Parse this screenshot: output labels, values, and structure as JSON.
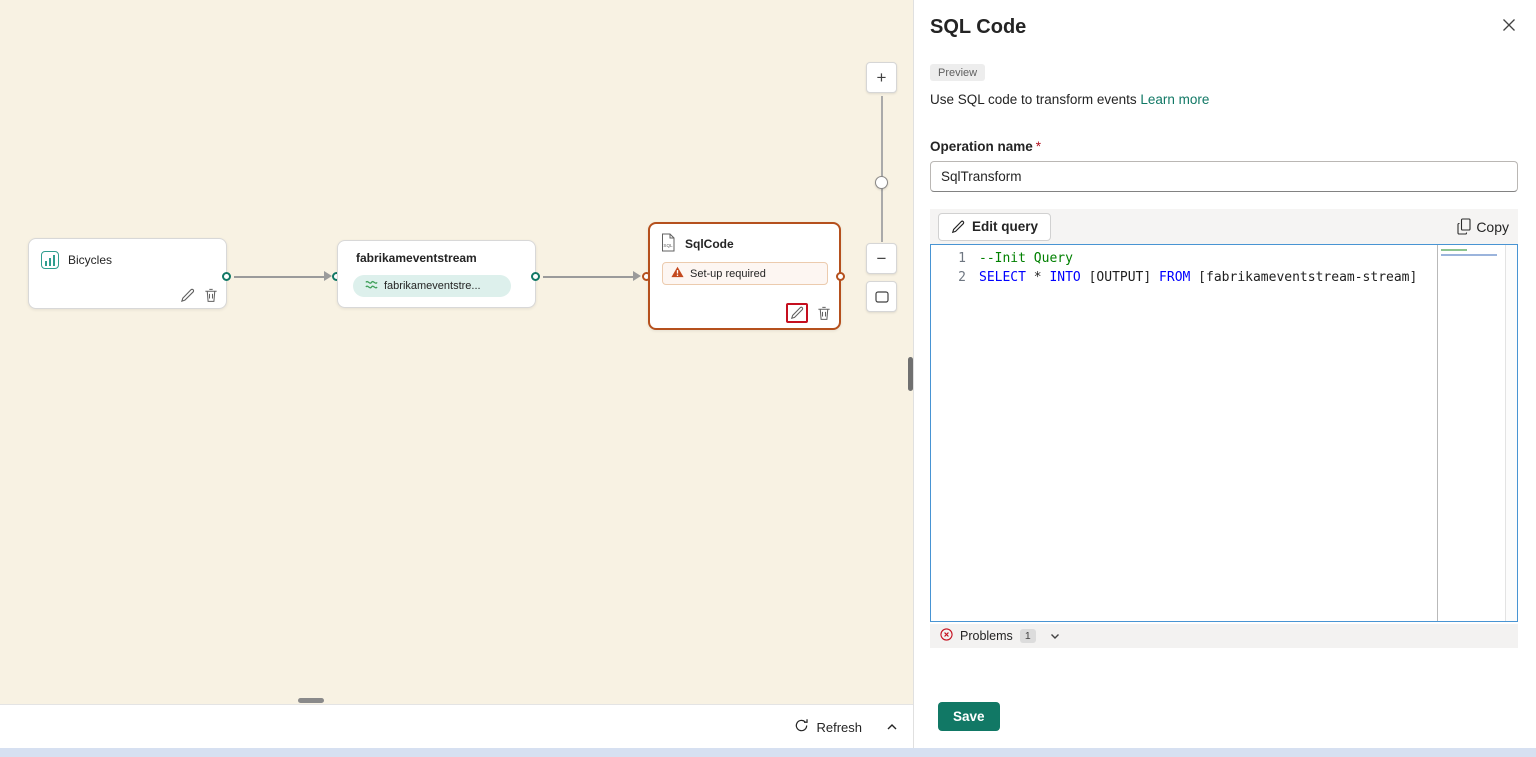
{
  "colors": {
    "accent_teal": "#117865",
    "warning_orange": "#b5501d",
    "error_red": "#c50f1f",
    "canvas_bg": "#f8f2e3",
    "keyword_blue": "#0000ff",
    "comment_green": "#008000"
  },
  "canvas": {
    "nodes": {
      "bicycles": {
        "title": "Bicycles"
      },
      "eventstream": {
        "title": "fabrikameventstream",
        "badge": "fabrikameventstre..."
      },
      "sqlcode": {
        "title": "SqlCode",
        "icon_label": "SQL",
        "warning": "Set-up required"
      }
    },
    "zoom": {
      "plus": "+",
      "minus": "−"
    },
    "refresh_label": "Refresh"
  },
  "panel": {
    "title": "SQL Code",
    "preview_badge": "Preview",
    "description": "Use SQL code to transform events ",
    "learn_more_label": "Learn more",
    "operation_name": {
      "label": "Operation name",
      "required": "*",
      "value": "SqlTransform"
    },
    "toolbar": {
      "edit_query_label": "Edit query",
      "copy_label": "Copy"
    },
    "editor": {
      "lines": [
        {
          "num": "1",
          "segments": [
            {
              "t": "--Init Query",
              "c": "comment"
            }
          ]
        },
        {
          "num": "2",
          "segments": [
            {
              "t": "SELECT",
              "c": "keyword"
            },
            {
              "t": " * ",
              "c": "plain"
            },
            {
              "t": "INTO",
              "c": "keyword"
            },
            {
              "t": " [OUTPUT] ",
              "c": "plain"
            },
            {
              "t": "FROM",
              "c": "keyword"
            },
            {
              "t": " [fabrikameventstream-stream]",
              "c": "plain"
            }
          ]
        }
      ]
    },
    "problems": {
      "label": "Problems",
      "count": "1"
    },
    "save_label": "Save"
  }
}
